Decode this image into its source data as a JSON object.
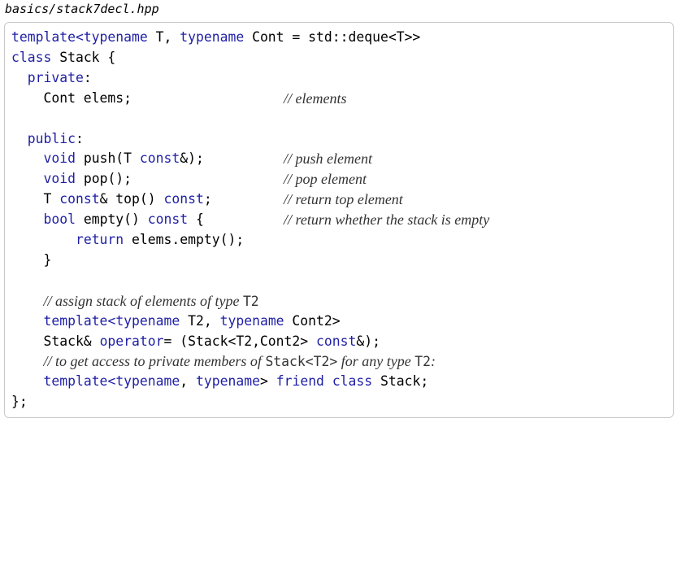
{
  "filename": "basics/stack7decl.hpp",
  "code": {
    "l1": {
      "a": "template<",
      "b": "typename",
      "c": " T, ",
      "d": "typename",
      "e": " Cont = std::deque<T>>"
    },
    "l2": {
      "a": "class",
      "b": " Stack {"
    },
    "l3": {
      "a": "  ",
      "b": "private",
      "c": ":"
    },
    "l4": {
      "a": "    Cont elems;",
      "comment": "// elements"
    },
    "l6": {
      "a": "  ",
      "b": "public",
      "c": ":"
    },
    "l7": {
      "a": "    ",
      "b": "void",
      "c": " push(T ",
      "d": "const",
      "e": "&);",
      "comment": "// push element"
    },
    "l8": {
      "a": "    ",
      "b": "void",
      "c": " pop();",
      "comment": "// pop element"
    },
    "l9": {
      "a": "    T ",
      "b": "const",
      "c": "& top() ",
      "d": "const",
      "e": ";",
      "comment": "// return top element"
    },
    "l10": {
      "a": "    ",
      "b": "bool",
      "c": " empty() ",
      "d": "const",
      "e": " {",
      "comment": "// return whether the stack is empty"
    },
    "l11": {
      "a": "        ",
      "b": "return",
      "c": " elems.empty();"
    },
    "l12": {
      "a": "    }"
    },
    "l14": {
      "comment_pre": "// assign stack of elements of type ",
      "comment_code": "T2"
    },
    "l15": {
      "a": "    ",
      "b": "template",
      "c": "<",
      "d": "typename",
      "e": " T2, ",
      "f": "typename",
      "g": " Cont2>"
    },
    "l16": {
      "a": "    Stack& ",
      "b": "operator",
      "c": "= (Stack<T2,Cont2> ",
      "d": "const",
      "e": "&);"
    },
    "l17": {
      "comment_pre": "// to get access to private members of ",
      "comment_code1": "Stack<T2>",
      "comment_mid": " for any type ",
      "comment_code2": "T2",
      "comment_post": ":"
    },
    "l18": {
      "a": "    ",
      "b": "template",
      "c": "<",
      "d": "typename",
      "e": ", ",
      "f": "typename",
      "g": "> ",
      "h": "friend",
      "i": " ",
      "j": "class",
      "k": " Stack;"
    },
    "l19": {
      "a": "};"
    }
  }
}
